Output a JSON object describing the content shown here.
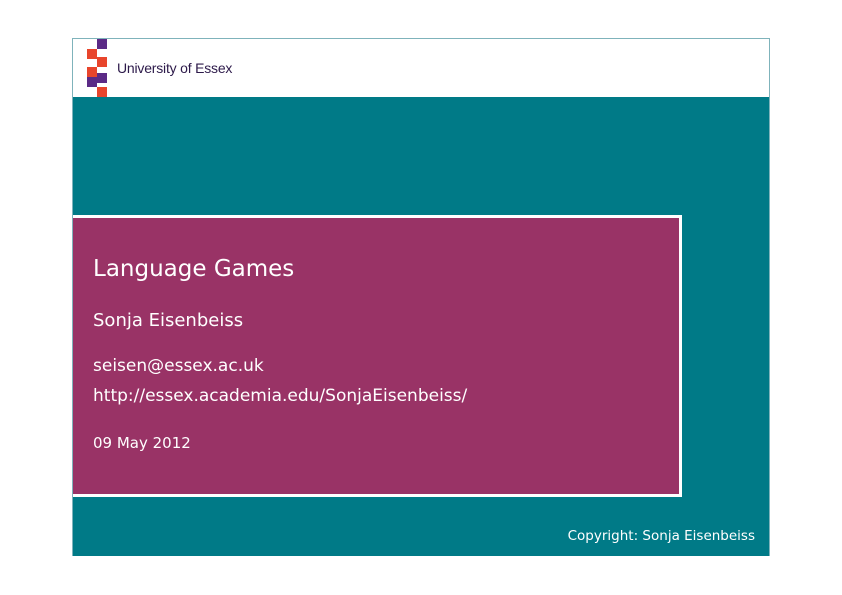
{
  "logo": {
    "text": "University of Essex",
    "colors": {
      "purple": "#5b2a86",
      "red": "#e8452c"
    }
  },
  "slide": {
    "title": "Language Games",
    "author": "Sonja Eisenbeiss",
    "email": "seisen@essex.ac.uk",
    "url": "http://essex.academia.edu/SonjaEisenbeiss/",
    "date": "09 May 2012"
  },
  "footer": {
    "copyright": "Copyright: Sonja Eisenbeiss"
  },
  "colors": {
    "teal": "#007a87",
    "title_box": "#993366"
  }
}
